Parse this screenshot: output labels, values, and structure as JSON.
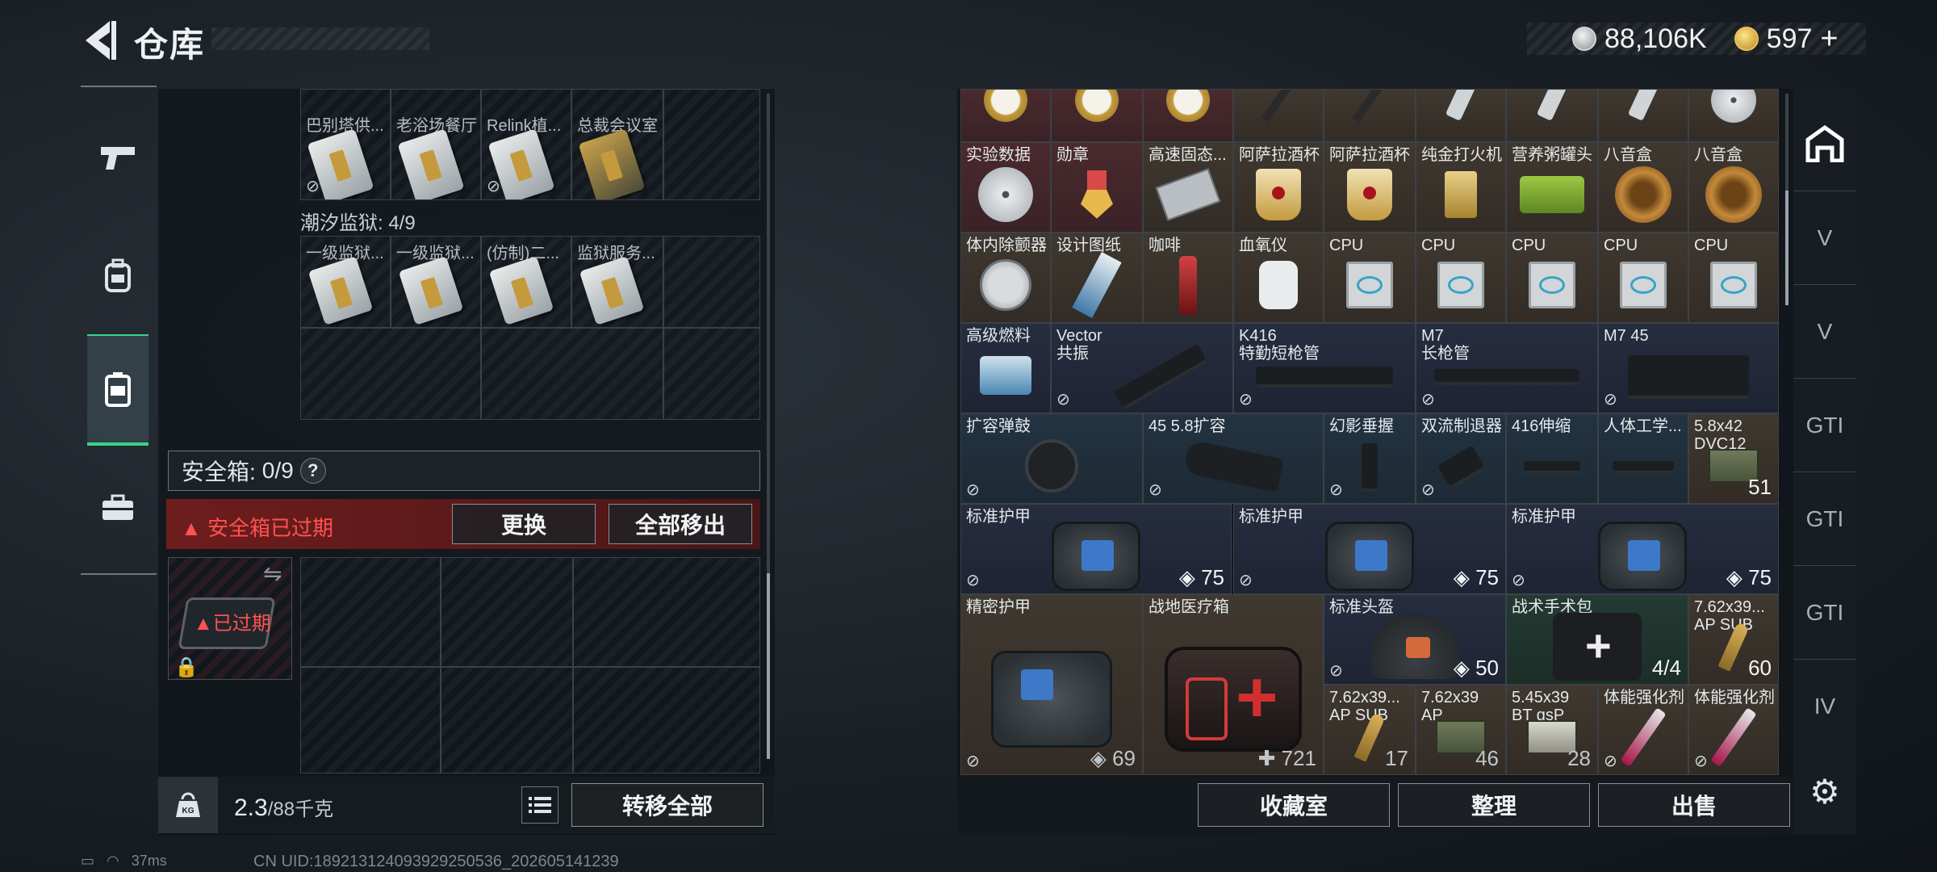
{
  "header": {
    "title": "仓库",
    "silver": "88,106K",
    "gold": "597",
    "gold_plus": "+"
  },
  "left_tabs": [
    {
      "name": "weapon-tab",
      "icon": "🔫"
    },
    {
      "name": "backpack-tab",
      "icon": "🎒"
    },
    {
      "name": "container-tab",
      "icon": "▮"
    },
    {
      "name": "toolbox-tab",
      "icon": "💼"
    }
  ],
  "top_row_items": [
    {
      "label": "巴别塔供..."
    },
    {
      "label": "老浴场餐厅"
    },
    {
      "label": "Relink植..."
    },
    {
      "label": "总裁会议室"
    }
  ],
  "prison": {
    "label": "潮汐监狱: 4/9"
  },
  "prison_items": [
    {
      "label": "一级监狱..."
    },
    {
      "label": "一级监狱..."
    },
    {
      "label": "(仿制)二..."
    },
    {
      "label": "监狱服务..."
    }
  ],
  "safebox": {
    "label": "安全箱:",
    "count": "0/9",
    "help": "?",
    "expired_message": "▲ 安全箱已过期",
    "replace_label": "更换",
    "remove_all_label": "全部移出",
    "slot_label": "▲已过期"
  },
  "weight": {
    "value": "2.3",
    "max": "/88千克",
    "transfer_all_label": "转移全部"
  },
  "status": {
    "ping": "37ms",
    "uid": "CN UID:189213124093929250536_202605141239"
  },
  "no_entry_glyph": "⊘",
  "inventory": [
    {
      "name": "实验数据",
      "count": ""
    },
    {
      "name": "勋章",
      "count": ""
    },
    {
      "name": "高速固态...",
      "count": ""
    },
    {
      "name": "阿萨拉酒杯",
      "count": ""
    },
    {
      "name": "阿萨拉酒杯",
      "count": ""
    },
    {
      "name": "纯金打火机",
      "count": ""
    },
    {
      "name": "营养粥罐头",
      "count": ""
    },
    {
      "name": "八音盒",
      "count": ""
    },
    {
      "name": "八音盒",
      "count": ""
    },
    {
      "name": "体内除颤器",
      "count": ""
    },
    {
      "name": "设计图纸",
      "count": ""
    },
    {
      "name": "咖啡",
      "count": ""
    },
    {
      "name": "血氧仪",
      "count": ""
    },
    {
      "name": "CPU",
      "count": ""
    },
    {
      "name": "CPU",
      "count": ""
    },
    {
      "name": "CPU",
      "count": ""
    },
    {
      "name": "CPU",
      "count": ""
    },
    {
      "name": "CPU",
      "count": ""
    },
    {
      "name": "高级燃料",
      "count": ""
    },
    {
      "name": "Vector\n共振",
      "count": ""
    },
    {
      "name": "K416\n特勤短枪管",
      "count": ""
    },
    {
      "name": "M7\n长枪管",
      "count": ""
    },
    {
      "name": "M7 45",
      "count": ""
    },
    {
      "name": "扩容弹鼓",
      "count": ""
    },
    {
      "name": "45 5.8扩容",
      "count": ""
    },
    {
      "name": "幻影垂握",
      "count": ""
    },
    {
      "name": "双流制退器",
      "count": ""
    },
    {
      "name": "416伸缩",
      "count": ""
    },
    {
      "name": "人体工学...",
      "count": ""
    },
    {
      "name": "5.8x42\nDVC12",
      "count": "51"
    },
    {
      "name": "标准护甲",
      "count": "75"
    },
    {
      "name": "标准护甲",
      "count": "75"
    },
    {
      "name": "标准护甲",
      "count": "75"
    },
    {
      "name": "精密护甲",
      "count": "69"
    },
    {
      "name": "战地医疗箱",
      "count": "721"
    },
    {
      "name": "标准头盔",
      "count": "50"
    },
    {
      "name": "战术手术包",
      "count": "4/4"
    },
    {
      "name": "7.62x39...\nAP SUB",
      "count": "60"
    },
    {
      "name": "7.62x39...\nAP SUB",
      "count": "17"
    },
    {
      "name": "7.62x39\nAP",
      "count": "46"
    },
    {
      "name": "5.45x39\nBT gsP",
      "count": "28"
    },
    {
      "name": "体能强化剂",
      "count": ""
    },
    {
      "name": "体能强化剂",
      "count": ""
    }
  ],
  "right_tabs": [
    {
      "name": "storage-tab",
      "icon": "⌂"
    },
    {
      "name": "level-v-tab-1",
      "icon": "V"
    },
    {
      "name": "level-v-tab-2",
      "icon": "V"
    },
    {
      "name": "level-gti-tab-1",
      "icon": "GTI"
    },
    {
      "name": "level-gti-tab-2",
      "icon": "GTI"
    },
    {
      "name": "level-gti-tab-3",
      "icon": "GTI"
    },
    {
      "name": "level-iv-tab",
      "icon": "IV"
    }
  ],
  "right_buttons": {
    "collection_label": "收藏室",
    "sort_label": "整理",
    "sell_label": "出售"
  },
  "colors": {
    "accent_green": "#39d38a",
    "warning_red": "#ff5151"
  }
}
